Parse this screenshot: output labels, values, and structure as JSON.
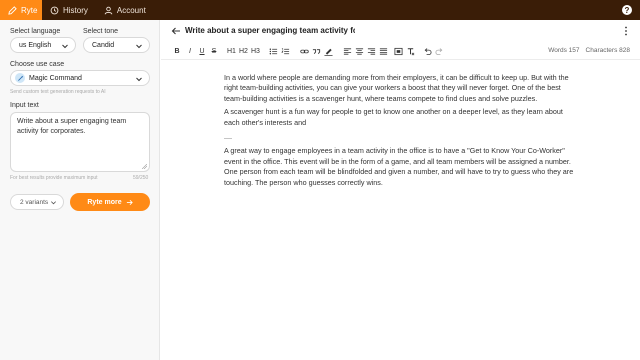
{
  "nav": {
    "tabs": [
      {
        "label": "Ryte",
        "icon": "edit-icon"
      },
      {
        "label": "History",
        "icon": "history-icon"
      },
      {
        "label": "Account",
        "icon": "user-icon"
      }
    ],
    "help_icon": "help-icon"
  },
  "sidebar": {
    "language_label": "Select language",
    "language_value": "us English",
    "tone_label": "Select tone",
    "tone_value": "Candid",
    "use_case_label": "Choose use case",
    "use_case_value": "Magic Command",
    "use_case_hint": "Send custom text generation requests to AI",
    "input_label": "Input text",
    "input_value": "Write about a super engaging team activity for corporates.",
    "input_hint": "For best results provide maximum input",
    "input_count": "59/250",
    "variants_label": "2 variants",
    "ryte_button_label": "Ryte more"
  },
  "editor": {
    "title": "Write about a super engaging team activity for corporates.",
    "toolbar": [
      "B",
      "I",
      "U",
      "S",
      "H1",
      "H2",
      "H3"
    ],
    "words_label": "Words 157",
    "chars_label": "Characters 828",
    "paragraphs": [
      "In a world where people are demanding more from their employers, it can be difficult to keep up. But with the right team-building activities, you can give your workers a boost that they will never forget. One of the best team-building activities is a scavenger hunt, where teams compete to find clues and solve puzzles.",
      "A scavenger hunt is a fun way for people to get to know one another on a deeper level, as they learn about each other's interests and",
      "----",
      "A great way to engage employees in a team activity in the office is to have a \"Get to Know Your Co-Worker\" event in the office. This event will be in the form of a game, and all team members will be assigned a number. One person from each team will be blindfolded and given a number, and will have to try to guess who they are touching. The person who guesses correctly wins."
    ]
  },
  "colors": {
    "accent": "#ff8a16",
    "topbar": "#3a1d07"
  }
}
